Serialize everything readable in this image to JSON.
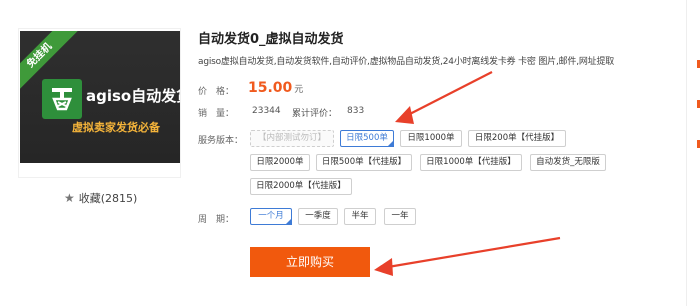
{
  "product": {
    "tag": "免挂机",
    "logo_icon": "press-icon",
    "brand": "agiso自动发货",
    "brand_sub": "虚拟卖家发货必备",
    "favorite": "收藏(2815)",
    "title": "自动发货0_虚拟自动发货",
    "description": "agiso虚拟自动发货,自动发货软件,自动评价,虚拟物品自动发货,24小时离线发卡券 卡密 图片,邮件,网址提取"
  },
  "price": {
    "label": "价　格：",
    "value": "15.00",
    "unit": "元"
  },
  "sales": {
    "label": "销　量：",
    "value": "23344",
    "reviews_label": "累计评价：",
    "reviews_value": "833"
  },
  "service": {
    "label": "服务版本：",
    "options": [
      "【内部测试勿订】",
      "日限500单",
      "日限1000单",
      "日限200单【代挂版】",
      "日限2000单",
      "日限500单【代挂版】",
      "日限1000单【代挂版】",
      "自动发货_无限版",
      "日限2000单【代挂版】"
    ],
    "selected": "日限500单"
  },
  "period": {
    "label": "周　期：",
    "options": [
      "一个月",
      "一季度",
      "半年",
      "一年"
    ],
    "selected": "一个月"
  },
  "buy_button": "立即购买",
  "colors": {
    "accent": "#f1590d",
    "price": "#f05a1e",
    "selected": "#3e7bd6",
    "annotation_arrow": "#e8402a"
  }
}
